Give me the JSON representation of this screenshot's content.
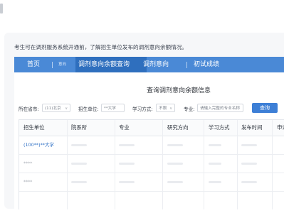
{
  "intro_text": "考生可在调剂服务系统开通前，了解招生单位发布的调剂意向余额情况。",
  "nav": {
    "home": "首页",
    "intent_small": "意向",
    "balance": "调剂意向余额查询",
    "intent": "调剂意向",
    "scores": "初试成绩"
  },
  "panel_title": "查询调剂意向余额信息",
  "filters": {
    "province_label": "所在省市:",
    "province_value": "(11)北京",
    "unit_label": "招生单位:",
    "unit_value": "**大学",
    "mode_label": "学习方式:",
    "mode_value": "不限",
    "major_label": "专业:",
    "major_placeholder": "请输入完整的专业名称",
    "search_button": "查询"
  },
  "table": {
    "headers": [
      "招生单位",
      "院系所",
      "专业",
      "研究方向",
      "学习方式",
      "发布时间",
      "申请"
    ],
    "rows": [
      {
        "unit": "(100**)**大学"
      },
      {
        "unit": "****"
      },
      {
        "unit": "****"
      }
    ]
  },
  "colors": {
    "nav_bg": "#4a89d6",
    "nav_active": "#2f6fbe",
    "link": "#2d6fc5",
    "button": "#3d7fd6"
  }
}
